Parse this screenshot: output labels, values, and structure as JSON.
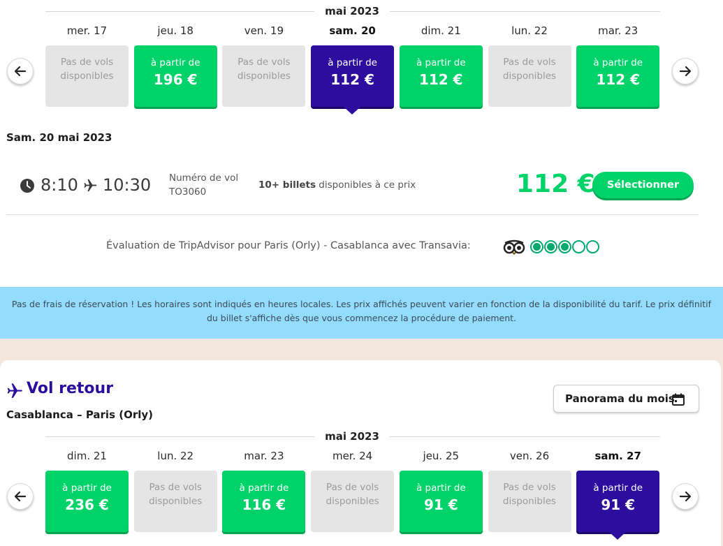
{
  "outbound": {
    "month": "mai 2023",
    "days": [
      {
        "day": "mer. 17",
        "status": "none",
        "text": "Pas de vols disponibles"
      },
      {
        "day": "jeu. 18",
        "status": "green",
        "from": "à partir de",
        "price": "196 €"
      },
      {
        "day": "ven. 19",
        "status": "none",
        "text": "Pas de vols disponibles"
      },
      {
        "day": "sam. 20",
        "status": "selected",
        "from": "à partir de",
        "price": "112 €"
      },
      {
        "day": "dim. 21",
        "status": "green",
        "from": "à partir de",
        "price": "112 €"
      },
      {
        "day": "lun. 22",
        "status": "none",
        "text": "Pas de vols disponibles"
      },
      {
        "day": "mar. 23",
        "status": "green",
        "from": "à partir de",
        "price": "112 €"
      }
    ],
    "selected_date": "Sam. 20 mai 2023",
    "flight": {
      "departure": "8:10",
      "arrival": "10:30",
      "flight_number_label": "Numéro de vol",
      "flight_number": "TO3060",
      "tickets_bold": "10+ billets",
      "tickets_rest": " disponibles à ce prix",
      "price": "112 €",
      "select_label": "Sélectionner"
    },
    "tripadvisor_text": "Évaluation de TripAdvisor pour Paris (Orly) - Casablanca avec Transavia:",
    "tripadvisor_rating": 3,
    "tripadvisor_max": 5
  },
  "info_banner": "Pas de frais de réservation ! Les horaires sont indiqués en heures locales. Les prix affichés peuvent varier en fonction de la disponibilité du tarif. Le prix définitif du billet s'affiche dès que vous commencez la procédure de paiement.",
  "return": {
    "title": "Vol retour",
    "route": "Casablanca – Paris (Orly)",
    "panorama_label": "Panorama du mois",
    "month": "mai 2023",
    "days": [
      {
        "day": "dim. 21",
        "status": "green",
        "from": "à partir de",
        "price": "236 €"
      },
      {
        "day": "lun. 22",
        "status": "none",
        "text": "Pas de vols disponibles"
      },
      {
        "day": "mar. 23",
        "status": "green",
        "from": "à partir de",
        "price": "116 €"
      },
      {
        "day": "mer. 24",
        "status": "none",
        "text": "Pas de vols disponibles"
      },
      {
        "day": "jeu. 25",
        "status": "green",
        "from": "à partir de",
        "price": "91 €"
      },
      {
        "day": "ven. 26",
        "status": "none",
        "text": "Pas de vols disponibles"
      },
      {
        "day": "sam. 27",
        "status": "selected",
        "from": "à partir de",
        "price": "91 €"
      }
    ]
  },
  "colors": {
    "green": "#00d26a",
    "navy": "#2c0e9e",
    "grey_tile": "#e5e5e5",
    "banner": "#93dcfc",
    "page_bg": "#f3e6dc",
    "tripadvisor": "#00aa6c"
  },
  "icons": {
    "prev": "arrow-left-icon",
    "next": "arrow-right-icon",
    "clock": "clock-icon",
    "plane": "plane-icon",
    "owl": "tripadvisor-owl-icon",
    "calendar": "calendar-icon"
  }
}
